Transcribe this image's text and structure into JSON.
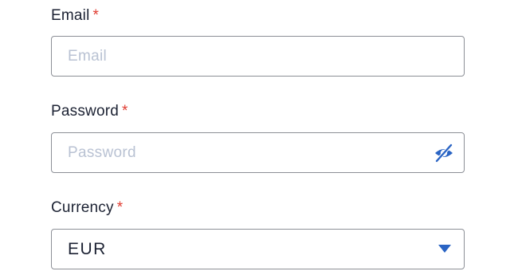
{
  "colors": {
    "accent": "#2a64c4",
    "required": "#e03c31",
    "border": "#8c8f96",
    "placeholder": "#b9c2d3",
    "text": "#1c2233"
  },
  "email": {
    "label": "Email",
    "required_mark": "*",
    "value": "",
    "placeholder": "Email"
  },
  "password": {
    "label": "Password",
    "required_mark": "*",
    "value": "",
    "placeholder": "Password",
    "toggle_icon": "eye-slash-icon"
  },
  "currency": {
    "label": "Currency",
    "required_mark": "*",
    "selected": "EUR",
    "dropdown_icon": "caret-down-icon"
  }
}
